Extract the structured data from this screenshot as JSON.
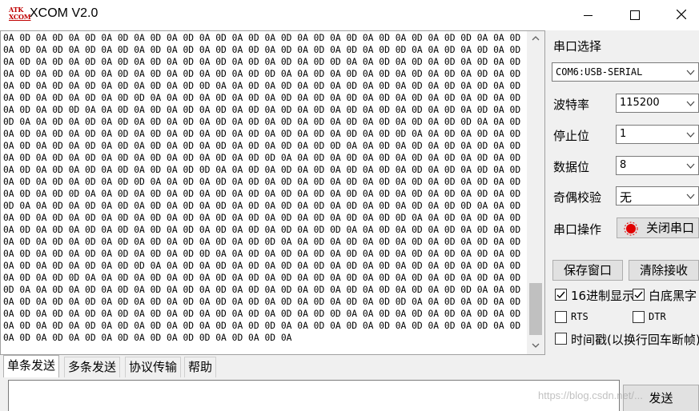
{
  "window": {
    "logo_top": "ATK",
    "logo_bottom": "XCOM",
    "title": "XCOM V2.0"
  },
  "receive": {
    "text": "0A 0D 0A 0D 0A 0D 0A 0D 0A 0D 0A 0D 0A 0D 0A 0D 0A 0D 0A 0D 0A 0D 0A 0D 0A 0D 0A 0D 0D 0A 0A 0D 0A 0D 0A 0D 0A 0D 0A 0D 0A 0D 0A 0D 0A 0D 0A 0D 0A 0D 0A 0D 0A 0D 0A 0D 0D 0A 0A 0D 0A 0D 0A 0D 0A 0D 0A 0D 0A 0D 0A 0D 0A 0D 0A 0D 0A 0D 0A 0D 0A 0D 0A 0D 0D 0A 0A 0D 0A 0D 0A 0D 0A 0D 0A 0D 0A 0D 0A 0D 0A 0D 0A 0D 0A 0D 0A 0D 0A 0D 0A 0D 0D 0A 0A 0D 0A 0D 0A 0D 0A 0D 0A 0D 0A 0D 0A 0D 0A 0D 0A 0D 0A 0D 0A 0D 0A 0D 0A 0D 0D 0A 0A 0D 0A 0D 0A 0D 0A 0D 0A 0D 0A 0D 0A 0D 0A 0D 0A 0D 0A 0D 0A 0D 0A 0D 0A 0D 0D 0A 0A 0D 0A 0D 0A 0D 0A 0D 0A 0D 0A 0D 0A 0D 0A 0D 0A 0D 0A 0D 0A 0D 0A 0D 0A 0D 0D 0A 0A 0D 0A 0D 0A 0D 0A 0D 0A 0D 0A 0D 0A 0D 0A 0D 0A 0D 0A 0D 0A 0D 0A 0D 0A 0D 0D 0A 0A 0D 0A 0D 0A 0D 0A 0D 0A 0D 0A 0D 0A 0D 0A 0D 0A 0D 0A 0D 0A 0D 0A 0D 0A 0D 0D 0A 0A 0D 0A 0D 0A 0D 0A 0D 0A 0D 0A 0D 0A 0D 0A 0D 0A 0D 0A 0D 0A 0D 0A 0D 0A 0D 0D 0A 0A 0D 0A 0D 0A 0D 0A 0D 0A 0D 0A 0D 0A 0D 0A 0D 0A 0D 0A 0D 0A 0D 0A 0D 0A 0D 0D 0A 0A 0D 0A 0D 0A 0D 0A 0D 0A 0D 0A 0D 0A 0D 0A 0D 0A 0D 0A 0D 0A 0D 0A 0D 0A 0D 0D 0A 0A 0D 0A 0D 0A 0D 0A 0D 0A 0D 0A 0D 0A 0D 0A 0D 0A 0D 0A 0D 0A 0D 0A 0D 0A 0D 0D 0A 0A 0D 0A 0D 0A 0D 0A 0D 0A 0D 0A 0D 0A 0D 0A 0D 0A 0D 0A 0D 0A 0D 0A 0D 0A 0D 0D 0A 0A 0D 0A 0D 0A 0D 0A 0D 0A 0D 0A 0D 0A 0D 0A 0D 0A 0D 0A 0D 0A 0D 0A 0D 0A 0D 0D 0A 0A 0D 0A 0D 0A 0D 0A 0D 0A 0D 0A 0D 0A 0D 0A 0D 0A 0D 0A 0D 0A 0D 0A 0D 0A 0D 0D 0A 0A 0D 0A 0D 0A 0D 0A 0D 0A 0D 0A 0D 0A 0D 0A 0D 0A 0D 0A 0D 0A 0D 0A 0D 0A 0D 0D 0A 0A 0D 0A 0D 0A 0D 0A 0D 0A 0D 0A 0D 0A 0D 0A 0D 0A 0D 0A 0D 0A 0D 0A 0D 0A 0D 0D 0A 0A 0D 0A 0D 0A 0D 0A 0D 0A 0D 0A 0D 0A 0D 0A 0D 0A 0D 0A 0D 0A 0D 0A 0D 0A 0D 0D 0A 0A 0D 0A 0D 0A 0D 0A 0D 0A 0D 0A 0D 0A 0D 0A 0D 0A 0D 0A 0D 0A 0D 0A 0D 0A 0D 0D 0A 0A 0D 0A 0D 0A 0D 0A 0D 0A 0D 0A 0D 0A 0D 0A 0D 0A 0D 0A 0D 0A 0D 0A 0D 0A 0D 0D 0A 0A 0D 0A 0D 0A 0D 0A 0D 0A 0D 0A 0D 0A 0D 0A 0D 0A 0D 0A 0D 0A 0D 0A 0D 0A 0D 0D 0A 0A 0D 0A 0D 0A 0D 0A 0D 0A 0D 0A 0D 0A 0D 0A 0D 0A 0D 0A 0D 0A 0D 0A 0D 0A 0D 0D 0A 0A 0D 0A 0D 0A 0D 0A 0D 0A 0D 0A 0D 0A 0D 0A 0D 0A 0D 0A 0D 0A 0D 0A 0D 0A 0D 0D 0A 0A 0D 0A 0D 0A 0D 0A 0D 0A 0D 0A 0D 0A 0D 0A 0D 0A 0D 0A 0D 0A 0D 0A 0D 0A 0D 0D 0A 0A 0D 0A 0D 0A 0D 0A 0D 0A 0D 0A 0D 0A 0D 0A 0D 0A 0D 0A 0D 0A 0D 0A 0D 0A 0D 0D 0A 0A 0D 0A 0D 0A 0D 0A 0D 0A 0D 0A 0D 0A 0D 0A 0D 0A 0D 0A 0D 0A 0D 0A 0D 0A 0D 0D 0A 0A 0D 0A 0D 0A 0D 0A 0D 0A 0D 0A 0D 0A 0D 0A 0D 0A 0D 0A 0D 0A 0D 0A 0D 0A 0D 0D 0A 0A 0D 0A 0D 0A 0D 0A 0D 0A 0D 0A 0D 0A 0D 0A 0D 0A 0D 0A 0D 0A 0D 0A 0D 0A 0D 0D 0A 0D 0A 0D 0A"
  },
  "panel": {
    "port_label": "串口选择",
    "port_value": "COM6:USB-SERIAL",
    "baud_label": "波特率",
    "baud_value": "115200",
    "stop_label": "停止位",
    "stop_value": "1",
    "data_label": "数据位",
    "data_value": "8",
    "parity_label": "奇偶校验",
    "parity_value": "无",
    "op_label": "串口操作",
    "open_close_button": "关闭串口",
    "save_button": "保存窗口",
    "clear_button": "清除接收",
    "hex_display": "16进制显示",
    "white_black": "白底黑字",
    "rts": "RTS",
    "dtr": "DTR",
    "timestamp": "时间戳(以换行回车断帧)"
  },
  "tabs": [
    "单条发送",
    "多条发送",
    "协议传输",
    "帮助"
  ],
  "send": {
    "send_button": "发送",
    "watermark": "https://blog.csdn.net/..."
  },
  "colors": {
    "led": "#e00000",
    "logo": "#c00000"
  }
}
